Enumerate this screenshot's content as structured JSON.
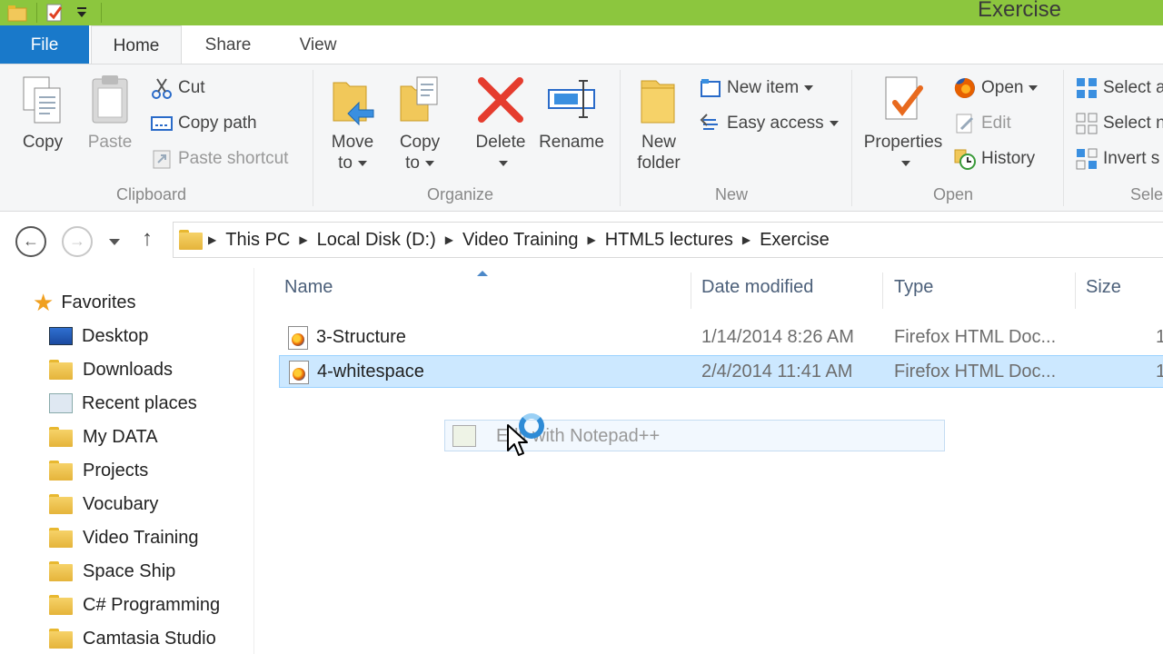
{
  "window": {
    "title": "Exercise"
  },
  "tabs": {
    "file": "File",
    "home": "Home",
    "share": "Share",
    "view": "View"
  },
  "ribbon": {
    "clipboard": {
      "label": "Clipboard",
      "copy": "Copy",
      "paste": "Paste",
      "cut": "Cut",
      "copy_path": "Copy path",
      "paste_shortcut": "Paste shortcut"
    },
    "organize": {
      "label": "Organize",
      "move_to_1": "Move",
      "move_to_2": "to",
      "copy_to_1": "Copy",
      "copy_to_2": "to",
      "delete": "Delete",
      "rename": "Rename"
    },
    "new": {
      "label": "New",
      "new_folder_1": "New",
      "new_folder_2": "folder",
      "new_item": "New item",
      "easy_access": "Easy access"
    },
    "open": {
      "label": "Open",
      "properties": "Properties",
      "open": "Open",
      "edit": "Edit",
      "history": "History"
    },
    "select": {
      "label": "Sele",
      "select_all": "Select a",
      "select_none": "Select n",
      "invert": "Invert s"
    }
  },
  "address": {
    "crumbs": [
      "This PC",
      "Local Disk (D:)",
      "Video Training",
      "HTML5 lectures",
      "Exercise"
    ]
  },
  "navpane": {
    "favorites": "Favorites",
    "items": [
      "Desktop",
      "Downloads",
      "Recent places",
      "My DATA",
      "Projects",
      "Vocubary",
      "Video Training",
      "Space Ship",
      "C# Programming",
      "Camtasia Studio"
    ]
  },
  "columns": {
    "name": "Name",
    "date": "Date modified",
    "type": "Type",
    "size": "Size"
  },
  "files": [
    {
      "name": "3-Structure",
      "date": "1/14/2014 8:26 AM",
      "type": "Firefox HTML Doc...",
      "size": "1"
    },
    {
      "name": "4-whitespace",
      "date": "2/4/2014 11:41 AM",
      "type": "Firefox HTML Doc...",
      "size": "1"
    }
  ],
  "drag_ghost": {
    "label": "Edit with Notepad++"
  },
  "colors": {
    "titlebar": "#8cc63e",
    "file_tab": "#1979ca",
    "selection": "#cce8ff"
  }
}
